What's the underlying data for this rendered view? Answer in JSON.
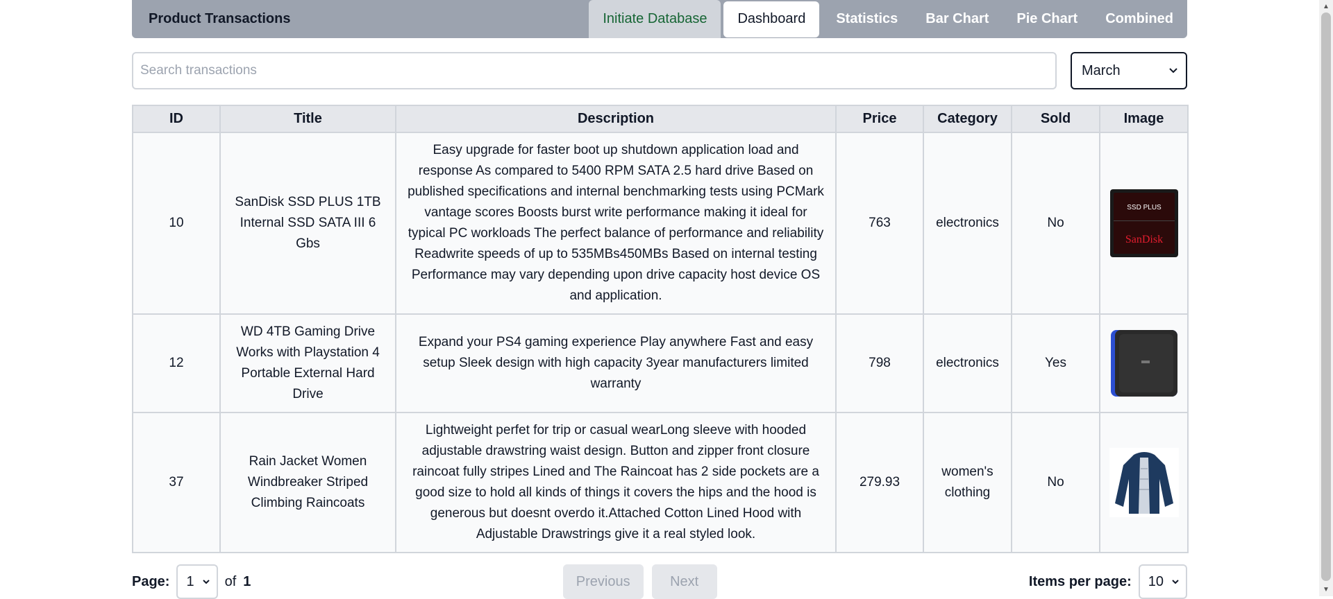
{
  "navbar": {
    "brand": "Product Transactions",
    "items": [
      {
        "label": "Initiate Database"
      },
      {
        "label": "Dashboard"
      },
      {
        "label": "Statistics"
      },
      {
        "label": "Bar Chart"
      },
      {
        "label": "Pie Chart"
      },
      {
        "label": "Combined"
      }
    ]
  },
  "search": {
    "placeholder": "Search transactions",
    "value": ""
  },
  "month_select": {
    "selected": "March"
  },
  "table": {
    "headers": [
      "ID",
      "Title",
      "Description",
      "Price",
      "Category",
      "Sold",
      "Image"
    ],
    "rows": [
      {
        "id": "10",
        "title": "SanDisk SSD PLUS 1TB Internal SSD SATA III 6 Gbs",
        "description": "Easy upgrade for faster boot up shutdown application load and response As compared to 5400 RPM SATA 2.5 hard drive Based on published specifications and internal benchmarking tests using PCMark vantage scores Boosts burst write performance making it ideal for typical PC workloads The perfect balance of performance and reliability Readwrite speeds of up to 535MBs450MBs Based on internal testing Performance may vary depending upon drive capacity host device OS and application.",
        "price": "763",
        "category": "electronics",
        "sold": "No",
        "image": {
          "icon": "ssd-image",
          "text_top": "SSD PLUS",
          "text_bottom": "SanDisk"
        }
      },
      {
        "id": "12",
        "title": "WD 4TB Gaming Drive Works with Playstation 4 Portable External Hard Drive",
        "description": "Expand your PS4 gaming experience Play anywhere Fast and easy setup Sleek design with high capacity 3year manufacturers limited warranty",
        "price": "798",
        "category": "electronics",
        "sold": "Yes",
        "image": {
          "icon": "hard-drive-image"
        }
      },
      {
        "id": "37",
        "title": "Rain Jacket Women Windbreaker Striped Climbing Raincoats",
        "description": "Lightweight perfet for trip or casual wearLong sleeve with hooded adjustable drawstring waist design. Button and zipper front closure raincoat fully stripes Lined and The Raincoat has 2 side pockets are a good size to hold all kinds of things it covers the hips and the hood is generous but doesnt overdo it.Attached Cotton Lined Hood with Adjustable Drawstrings give it a real styled look.",
        "price": "279.93",
        "category": "women's clothing",
        "sold": "No",
        "image": {
          "icon": "jacket-image"
        }
      }
    ]
  },
  "pagination": {
    "page_label": "Page:",
    "page_value": "1",
    "of_label": "of",
    "total_pages": "1",
    "previous_label": "Previous",
    "next_label": "Next",
    "items_per_page_label": "Items per page:",
    "items_per_page_value": "10"
  },
  "colors": {
    "navbar_bg": "#9ca3af",
    "initiate_text": "#166534",
    "table_header_bg": "#e5e7eb",
    "table_cell_bg": "#f9fafb"
  }
}
